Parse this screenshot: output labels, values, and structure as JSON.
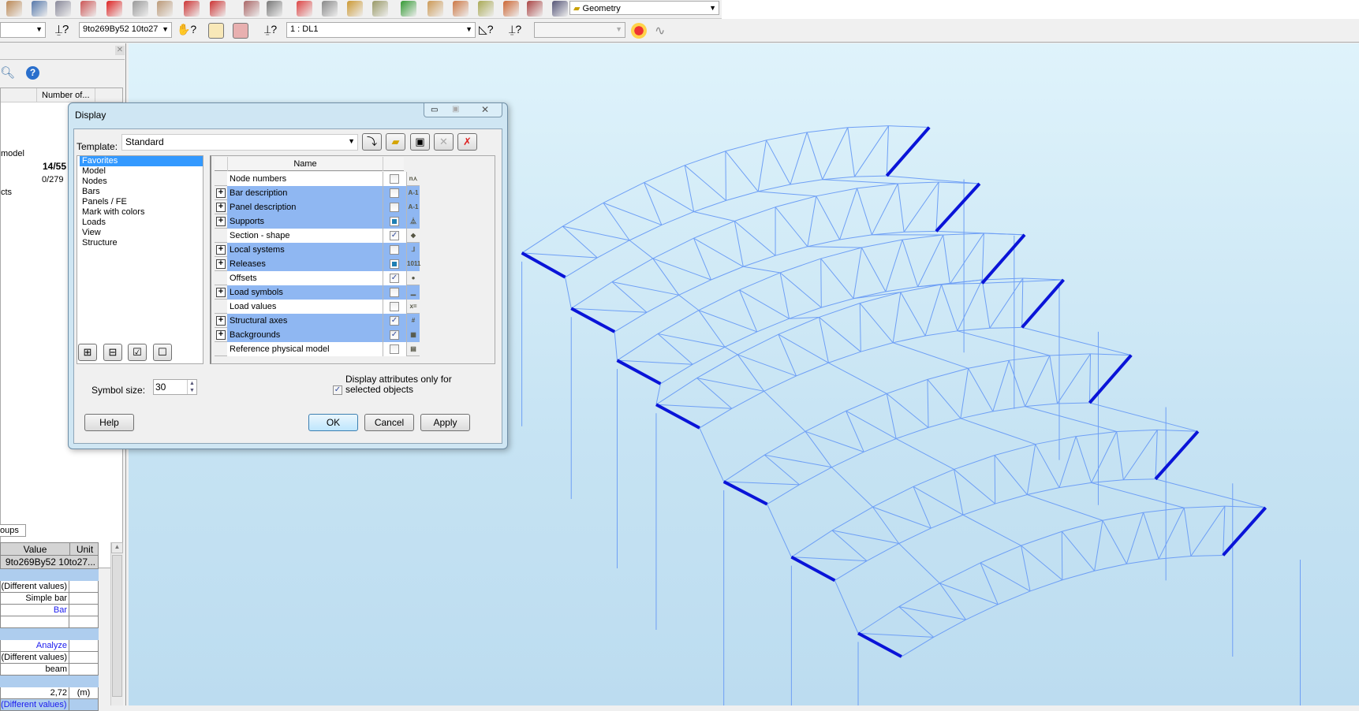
{
  "toolbar": {
    "view_mode": "Geometry",
    "bar_selection": "9to269By52 10to27",
    "load_case": "1 : DL1",
    "empty_combo": ""
  },
  "left_panel": {
    "column_header": "Number of...",
    "rows": [
      {
        "label": "model",
        "value": ""
      },
      {
        "label": "",
        "value": "14/55"
      },
      {
        "label": "",
        "value": "0/279"
      },
      {
        "label": "cts",
        "value": ""
      }
    ],
    "tab_label": "oups",
    "property_grid": {
      "headers": {
        "value": "Value",
        "unit": "Unit"
      },
      "title_value": "9to269By52 10to27...",
      "rows": [
        {
          "type": "band"
        },
        {
          "value": "(Different values)",
          "unit": ""
        },
        {
          "value": "Simple bar",
          "unit": ""
        },
        {
          "value": "Bar",
          "unit": "",
          "link": true
        },
        {
          "value": "",
          "unit": ""
        },
        {
          "type": "band"
        },
        {
          "value": "Analyze",
          "unit": "",
          "link": true
        },
        {
          "value": "(Different values)",
          "unit": ""
        },
        {
          "value": "beam",
          "unit": ""
        },
        {
          "type": "band"
        },
        {
          "value": "2,72",
          "unit": "(m)"
        },
        {
          "value": "(Different values)",
          "unit": "",
          "link": true,
          "band": true
        }
      ]
    }
  },
  "dialog": {
    "title": "Display",
    "template_label": "Template:",
    "template_value": "Standard",
    "categories": [
      "Favorites",
      "Model",
      "Nodes",
      "Bars",
      "Panels / FE",
      "Mark with colors",
      "Loads",
      "View",
      "Structure"
    ],
    "selected_category": "Favorites",
    "grid_header": "Name",
    "items": [
      {
        "name": "Node numbers",
        "expandable": false,
        "state": "unchecked",
        "icon": "node-numbers-icon",
        "glyph": "n⋏"
      },
      {
        "name": "Bar description",
        "expandable": true,
        "state": "unchecked",
        "icon": "bar-description-icon",
        "glyph": "A-1"
      },
      {
        "name": "Panel description",
        "expandable": true,
        "state": "unchecked",
        "icon": "panel-description-icon",
        "glyph": "A-1"
      },
      {
        "name": "Supports",
        "expandable": true,
        "state": "partial",
        "icon": "supports-icon",
        "glyph": "⏅"
      },
      {
        "name": "Section - shape",
        "expandable": false,
        "state": "checked",
        "icon": "section-shape-icon",
        "glyph": "◆"
      },
      {
        "name": "Local systems",
        "expandable": true,
        "state": "unchecked",
        "icon": "local-systems-icon",
        "glyph": "⅃"
      },
      {
        "name": "Releases",
        "expandable": true,
        "state": "partial",
        "icon": "releases-icon",
        "glyph": "1011"
      },
      {
        "name": "Offsets",
        "expandable": false,
        "state": "checked",
        "icon": "offsets-icon",
        "glyph": "●"
      },
      {
        "name": "Load symbols",
        "expandable": true,
        "state": "unchecked",
        "icon": "load-symbols-icon",
        "glyph": "▁"
      },
      {
        "name": "Load values",
        "expandable": false,
        "state": "unchecked",
        "icon": "load-values-icon",
        "glyph": "x="
      },
      {
        "name": "Structural axes",
        "expandable": true,
        "state": "checked",
        "icon": "structural-axes-icon",
        "glyph": "#"
      },
      {
        "name": "Backgrounds",
        "expandable": true,
        "state": "checked",
        "icon": "backgrounds-icon",
        "glyph": "▦"
      },
      {
        "name": "Reference physical model",
        "expandable": false,
        "state": "unchecked",
        "icon": "reference-model-icon",
        "glyph": "▤"
      }
    ],
    "symbol_size_label": "Symbol size:",
    "symbol_size_value": "30",
    "display_attr_label_1": "Display attributes only for",
    "display_attr_label_2": "selected objects",
    "display_attr_checked": true,
    "buttons": {
      "help": "Help",
      "ok": "OK",
      "cancel": "Cancel",
      "apply": "Apply"
    }
  },
  "colors": {
    "viewport_bg": "#d4ecf8",
    "structure_line": "#6e9ff5",
    "selected_bar": "#0a14d8",
    "highlight_row": "#8fb7f2",
    "selection": "#3399ff"
  }
}
